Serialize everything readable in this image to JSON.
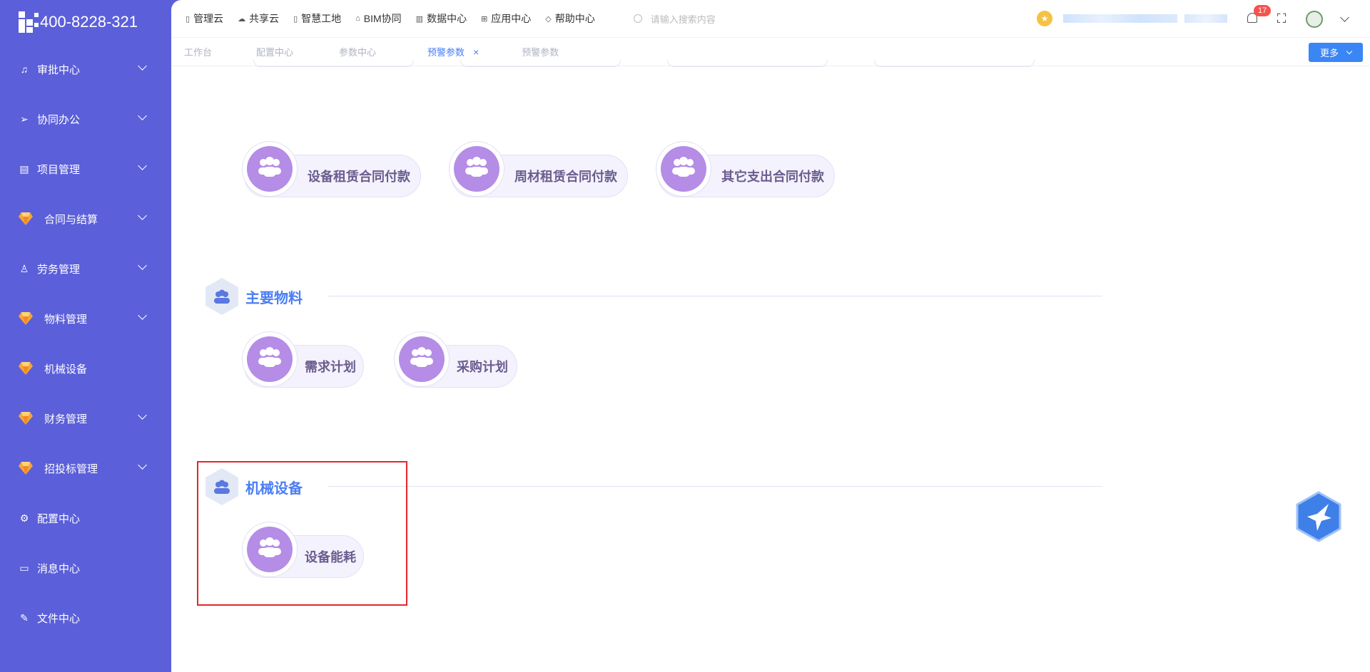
{
  "sidebar": {
    "phone": "400-8228-321",
    "items": [
      {
        "label": "审批中心",
        "icon": "bell-icon",
        "expand": true
      },
      {
        "label": "协同办公",
        "icon": "send-icon",
        "expand": true
      },
      {
        "label": "项目管理",
        "icon": "book-icon",
        "expand": true
      },
      {
        "label": "合同与结算",
        "icon": "gem-icon",
        "expand": true
      },
      {
        "label": "劳务管理",
        "icon": "person-icon",
        "expand": true
      },
      {
        "label": "物料管理",
        "icon": "gem-icon",
        "expand": true
      },
      {
        "label": "机械设备",
        "icon": "gem-icon",
        "expand": false
      },
      {
        "label": "财务管理",
        "icon": "gem-icon",
        "expand": true
      },
      {
        "label": "招投标管理",
        "icon": "gem-icon",
        "expand": true
      },
      {
        "label": "配置中心",
        "icon": "gear-icon",
        "expand": false
      },
      {
        "label": "消息中心",
        "icon": "chat-icon",
        "expand": false
      },
      {
        "label": "文件中心",
        "icon": "edit-icon",
        "expand": false
      }
    ]
  },
  "topnav": {
    "items": [
      "管理云",
      "共享云",
      "智慧工地",
      "BIM协同",
      "数据中心",
      "应用中心",
      "帮助中心"
    ],
    "search_placeholder": "请输入搜索内容",
    "badge_count": "17"
  },
  "tabs": {
    "items": [
      {
        "label": "工作台",
        "active": false
      },
      {
        "label": "配置中心",
        "active": false
      },
      {
        "label": "参数中心",
        "active": false
      },
      {
        "label": "预警参数",
        "active": true
      },
      {
        "label": "预警参数",
        "active": false
      }
    ],
    "close_glyph": "×",
    "more_label": "更多"
  },
  "sections": {
    "contract_modules": [
      "设备租赁合同付款",
      "周材租赁合同付款",
      "其它支出合同付款"
    ],
    "material": {
      "title": "主要物料",
      "modules": [
        "需求计划",
        "采购计划"
      ]
    },
    "machinery": {
      "title": "机械设备",
      "modules": [
        "设备能耗"
      ]
    }
  },
  "colors": {
    "sidebar_bg": "#5b5fd9",
    "accent": "#4a7df5",
    "module_circle": "#b58ce6",
    "highlight": "#e5262b"
  }
}
